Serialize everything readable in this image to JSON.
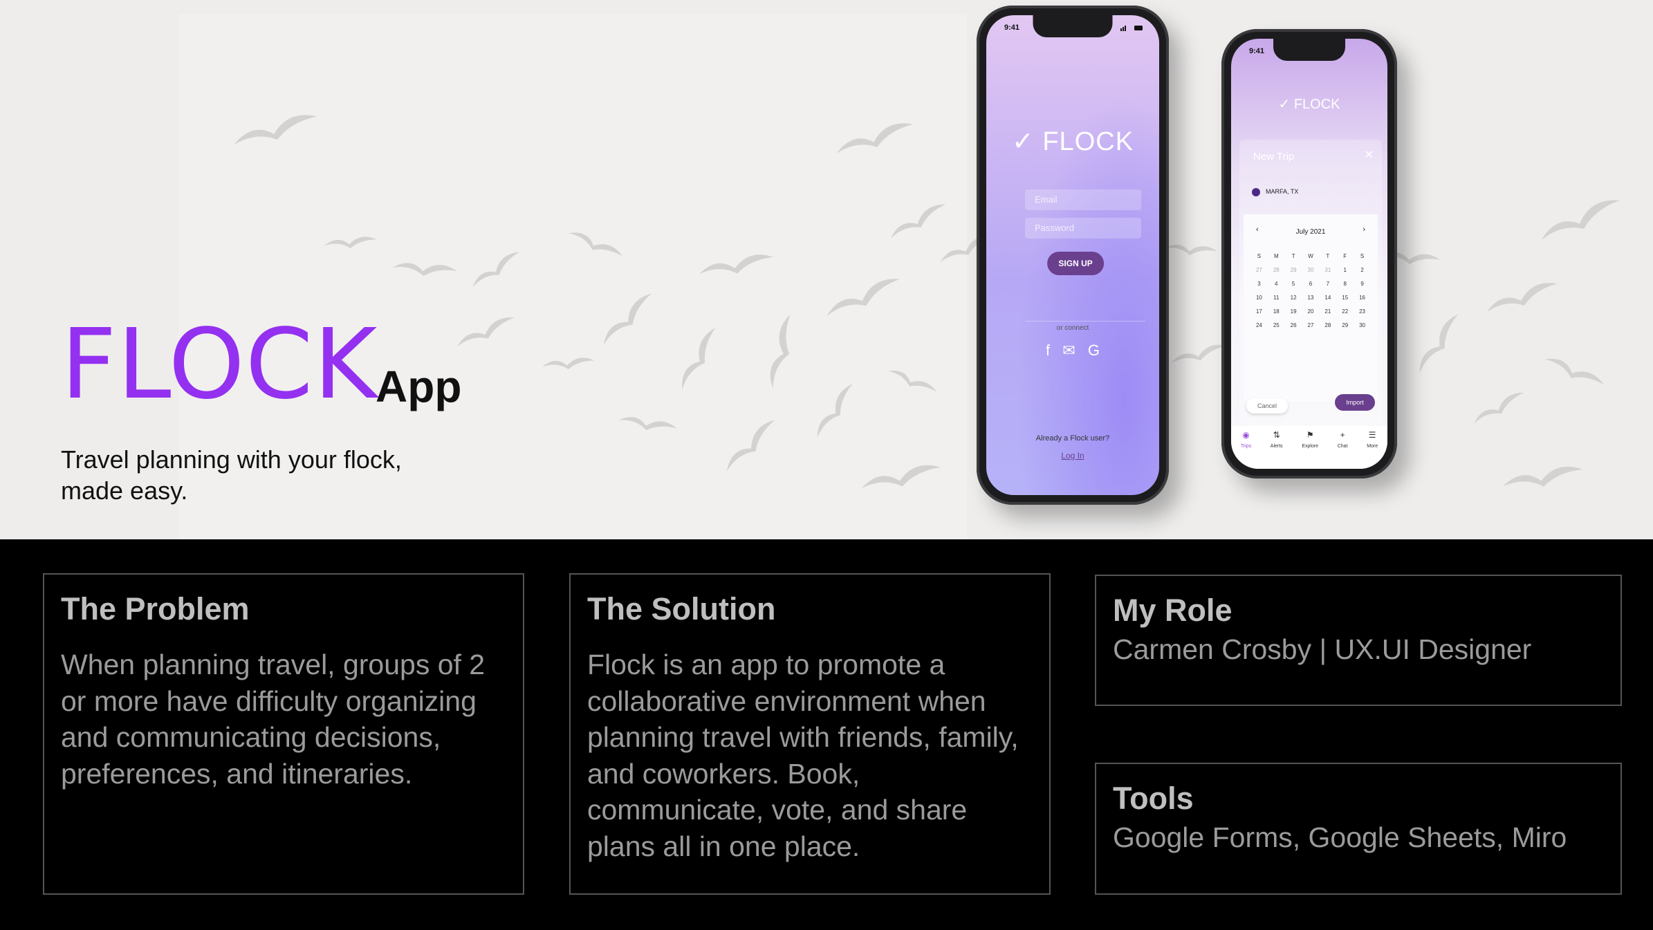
{
  "hero": {
    "brand_name": "FLOCK",
    "brand_suffix": "App",
    "tagline_line1": "Travel planning with your flock,",
    "tagline_line2": "made easy."
  },
  "colors": {
    "accent": "#9430f0",
    "button": "#6a3f8e",
    "box_border": "#555555"
  },
  "phone_login": {
    "time": "9:41",
    "logo": "FLOCK",
    "email_placeholder": "Email",
    "password_placeholder": "Password",
    "signup_label": "SIGN UP",
    "or_connect": "or connect",
    "social_icons": [
      "facebook-icon",
      "outlook-icon",
      "google-icon"
    ],
    "already_text": "Already a Flock user?",
    "login_label": "Log In"
  },
  "phone_trip": {
    "time": "9:41",
    "logo": "FLOCK",
    "card_title": "New Trip",
    "location": "MARFA, TX",
    "month": "July 2021",
    "weekdays": [
      "S",
      "M",
      "T",
      "W",
      "T",
      "F",
      "S"
    ],
    "days": [
      "27",
      "28",
      "29",
      "30",
      "31",
      "1",
      "2",
      "3",
      "4",
      "5",
      "6",
      "7",
      "8",
      "9",
      "10",
      "11",
      "12",
      "13",
      "14",
      "15",
      "16",
      "17",
      "18",
      "19",
      "20",
      "21",
      "22",
      "23",
      "24",
      "25",
      "26",
      "27",
      "28",
      "29",
      "30"
    ],
    "cancel_label": "Cancel",
    "import_label": "Import",
    "tabs": [
      "Trips",
      "Alerts",
      "Explore",
      "Chat",
      "More"
    ]
  },
  "boxes": {
    "problem": {
      "heading": "The Problem",
      "text": "When planning travel, groups of 2 or more have difficulty organizing and communicating decisions, preferences, and itineraries."
    },
    "solution": {
      "heading": "The Solution",
      "text": "Flock is an app to promote a collaborative environment when planning travel with friends, family, and coworkers. Book, communicate, vote, and share plans all in one place."
    },
    "role": {
      "heading": "My Role",
      "text": "Carmen Crosby | UX.UI Designer"
    },
    "tools": {
      "heading": "Tools",
      "text": "Google Forms, Google Sheets, Miro"
    }
  }
}
